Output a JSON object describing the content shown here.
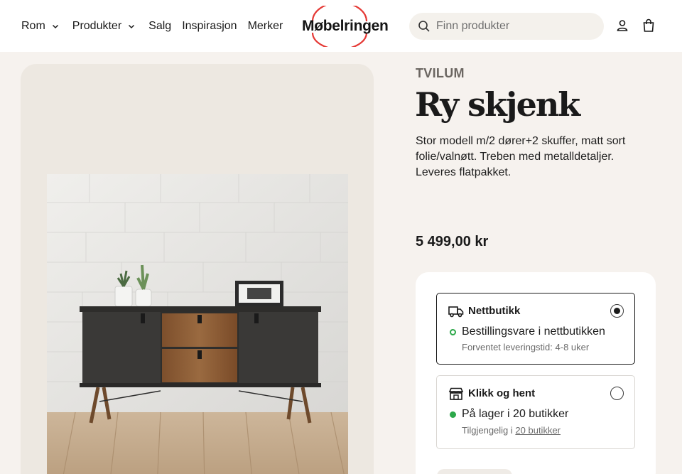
{
  "header": {
    "nav": [
      {
        "label": "Rom",
        "has_dropdown": true
      },
      {
        "label": "Produkter",
        "has_dropdown": true
      },
      {
        "label": "Salg",
        "has_dropdown": false
      },
      {
        "label": "Inspirasjon",
        "has_dropdown": false
      },
      {
        "label": "Merker",
        "has_dropdown": false
      }
    ],
    "logo_text": "Møbelringen",
    "search_placeholder": "Finn produkter",
    "icons": [
      "search-icon",
      "user-icon",
      "shopping-bag-icon"
    ]
  },
  "product": {
    "brand": "TVILUM",
    "title": "Ry skjenk",
    "description": "Stor modell m/2 dører+2 skuffer, matt sort folie/valnøtt. Treben med metalldetaljer. Leveres flatpakket.",
    "price": "5 499,00 kr"
  },
  "delivery": {
    "options": [
      {
        "title": "Nettbutikk",
        "icon": "truck-icon",
        "selected": true,
        "status": "Bestillingsvare i nettbutikken",
        "status_indicator": "ring",
        "detail": "Forventet leveringstid: 4-8 uker"
      },
      {
        "title": "Klikk og hent",
        "icon": "store-icon",
        "selected": false,
        "status": "På lager i 20 butikker",
        "status_indicator": "filled",
        "detail_prefix": "Tilgjengelig i",
        "detail_link": "20 butikker"
      }
    ]
  },
  "colors": {
    "logo_ring": "#e53935",
    "status_green": "#2da84a",
    "page_bg": "#f6f2ee",
    "image_panel_bg": "#ede8e1"
  }
}
